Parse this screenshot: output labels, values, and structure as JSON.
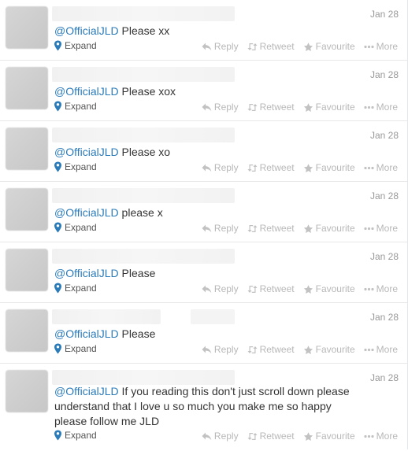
{
  "actions": {
    "reply": "Reply",
    "retweet": "Retweet",
    "favourite": "Favourite",
    "more": "More",
    "expand": "Expand"
  },
  "tweets": [
    {
      "date": "Jan 28",
      "mention": "@OfficialJLD",
      "text": " Please xx"
    },
    {
      "date": "Jan 28",
      "mention": "@OfficialJLD",
      "text": " Please xox"
    },
    {
      "date": "Jan 28",
      "mention": "@OfficialJLD",
      "text": " Please xo"
    },
    {
      "date": "Jan 28",
      "mention": "@OfficialJLD",
      "text": " please x"
    },
    {
      "date": "Jan 28",
      "mention": "@OfficialJLD",
      "text": " Please"
    },
    {
      "date": "Jan 28",
      "mention": "@OfficialJLD",
      "text": " Please"
    },
    {
      "date": "Jan 28",
      "mention": "@OfficialJLD",
      "text": " If you reading this don't just scroll down please understand that I love u so much you make me so happy  please follow me JLD"
    }
  ],
  "colors": {
    "link": "#2b7bb9",
    "action": "#b8b8b8",
    "date": "#999999"
  }
}
